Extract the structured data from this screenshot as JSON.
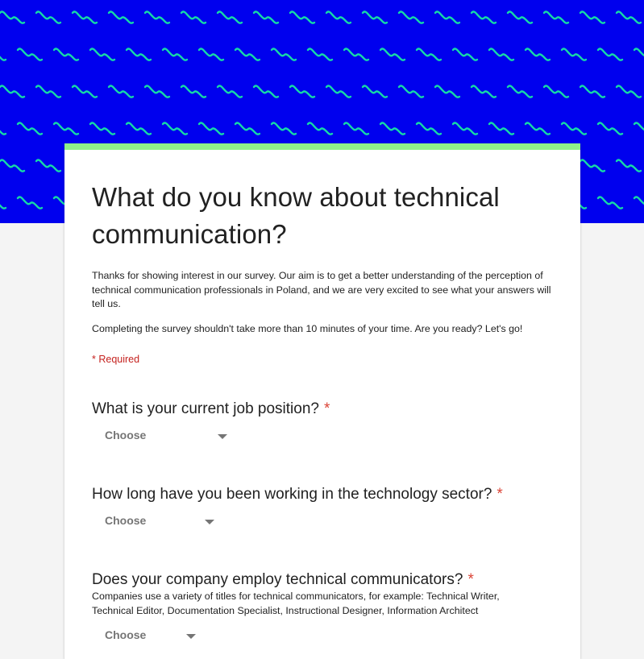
{
  "colors": {
    "banner_background": "#0000ee",
    "banner_pattern": "#16d9a6",
    "accent_bar": "#8ef08a",
    "required": "#c5221f"
  },
  "banner": {
    "pattern_icon": "wavy-lines-pattern"
  },
  "form": {
    "title": "What do you know about technical communication?",
    "description_1": "Thanks for showing interest in our survey. Our aim is to get a better understanding of the perception of technical communication professionals in Poland, and we are very excited to see what your answers will tell us.",
    "description_2": "Completing the survey shouldn't take more than 10 minutes of your time. Are you ready? Let's go!",
    "required_note": "* Required"
  },
  "questions": [
    {
      "label": "What is your current job position?",
      "required_mark": "*",
      "select_value": "Choose",
      "select_icon": "dropdown-arrow-icon"
    },
    {
      "label": "How long have you been working in the technology sector?",
      "required_mark": "*",
      "select_value": "Choose",
      "select_icon": "dropdown-arrow-icon"
    },
    {
      "label": "Does your company employ technical communicators?",
      "required_mark": "*",
      "help_text": "Companies use a variety of titles for technical communicators, for example: Technical Writer, Technical Editor, Documentation Specialist, Instructional Designer, Information Architect",
      "select_value": "Choose",
      "select_icon": "dropdown-arrow-icon"
    }
  ]
}
